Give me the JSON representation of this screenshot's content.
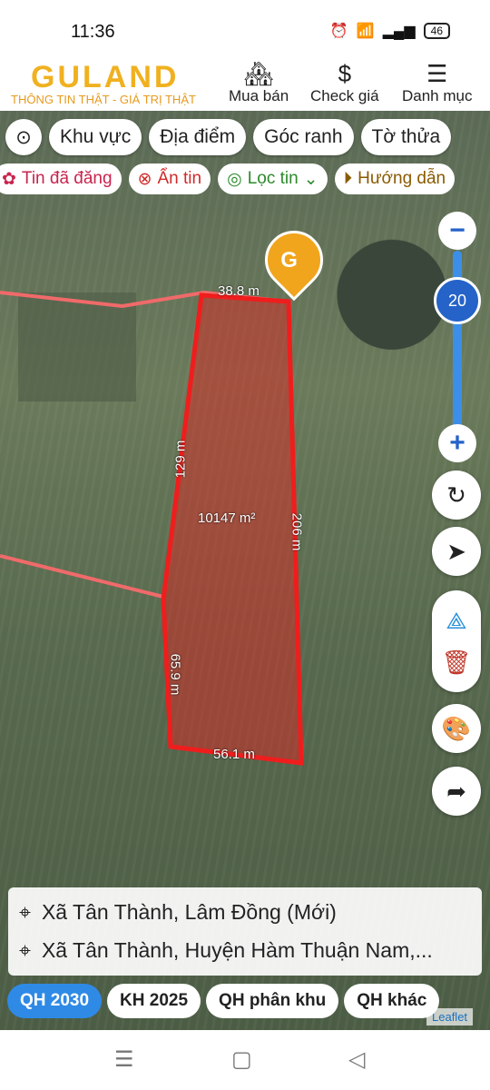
{
  "status": {
    "time": "11:36",
    "battery": "46"
  },
  "brand": {
    "logo": "GULAND",
    "slogan": "THÔNG TIN THẬT - GIÁ TRỊ THẬT"
  },
  "nav": [
    {
      "label": "Mua bán"
    },
    {
      "label": "Check giá"
    },
    {
      "label": "Danh mục"
    }
  ],
  "chips": [
    "Khu vực",
    "Địa điểm",
    "Góc ranh",
    "Tờ thửa"
  ],
  "filters": [
    "Tin đã đăng",
    "Ẩn tin",
    "Lọc tin",
    "Hướng dẫn"
  ],
  "map": {
    "zoom": "20",
    "area": "10147 m²",
    "edges": [
      "38.8 m",
      "129 m",
      "206 m",
      "65.9 m",
      "56.1 m"
    ],
    "attribution": "Leaflet"
  },
  "address": {
    "line1": "Xã Tân Thành, Lâm Đồng (Mới)",
    "line2": "Xã Tân Thành, Huyện Hàm Thuận Nam,..."
  },
  "tabs": [
    "QH 2030",
    "KH 2025",
    "QH phân khu",
    "QH khác"
  ],
  "colors": {
    "accent": "#f0b120",
    "active_tab": "#2f8ae6",
    "parcel": "#e8221d"
  }
}
